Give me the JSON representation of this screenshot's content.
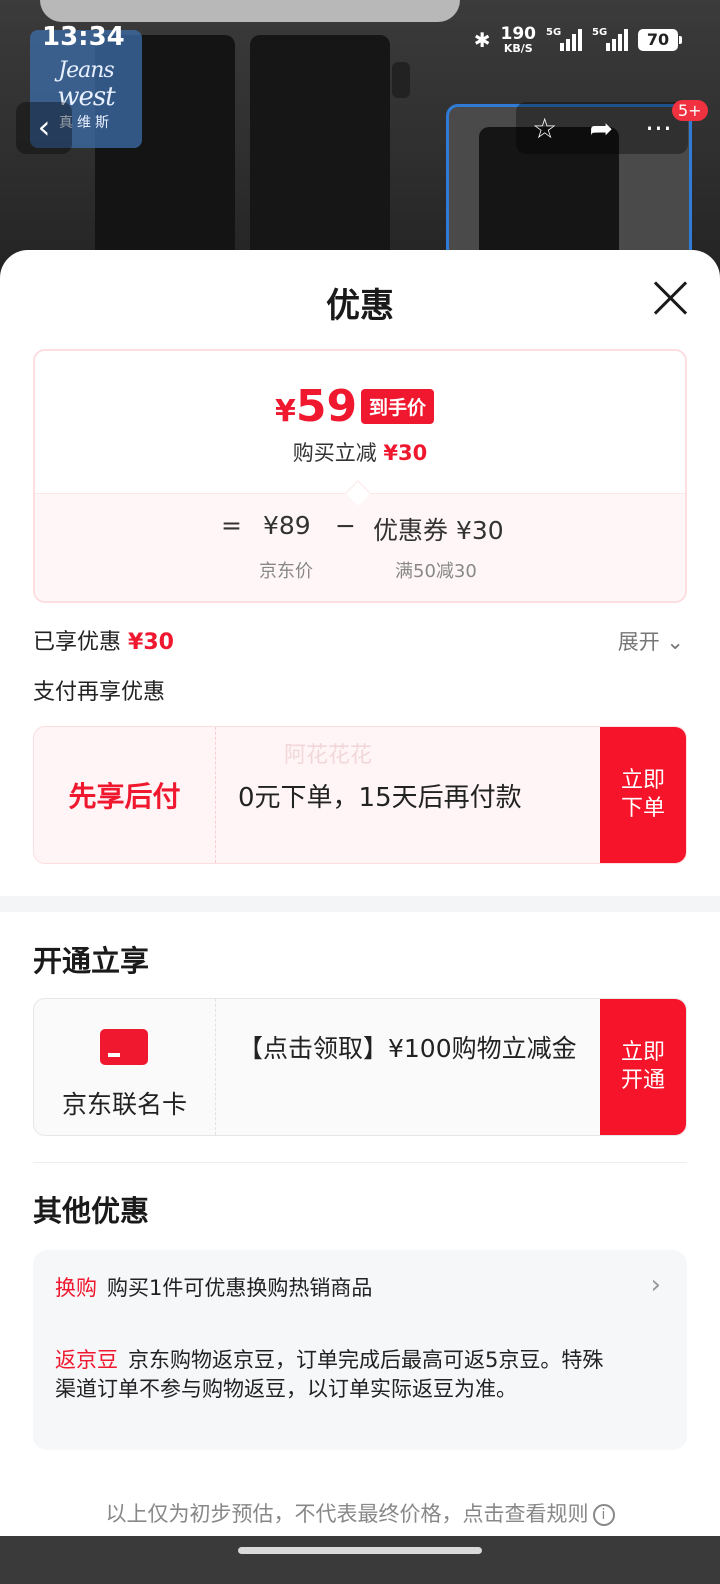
{
  "status_bar": {
    "time": "13:34",
    "net_speed_value": "190",
    "net_speed_unit": "KB/S",
    "signal1_label": "5G",
    "signal2_label": "5G",
    "battery": "70"
  },
  "brand": {
    "line1": "Jeans",
    "line2": "west",
    "line3": "真维斯"
  },
  "nav": {
    "notification_badge": "5+"
  },
  "sheet": {
    "title": "优惠",
    "price_card": {
      "currency": "¥",
      "final_price": "59",
      "final_tag": "到手价",
      "reduce_text": "购买立减",
      "reduce_amount": "¥30",
      "equals": "=",
      "jd_price": "¥89",
      "minus": "−",
      "coupon_text": "优惠券 ¥30",
      "jd_price_label": "京东价",
      "coupon_rule": "满50减30"
    },
    "enjoyed_label": "已享优惠",
    "enjoyed_amount": "¥30",
    "expand_label": "展开",
    "pay_again_label": "支付再享优惠",
    "pay_later": {
      "title": "先享后付",
      "desc": "0元下单，15天后再付款",
      "watermark": "阿花花花",
      "button": "立即下单"
    },
    "open_section_title": "开通立享",
    "card_offer": {
      "name": "京东联名卡",
      "desc": "【点击领取】¥100购物立减金",
      "button": "立即开通"
    },
    "other_section_title": "其他优惠",
    "other": {
      "exchange_label": "换购",
      "exchange_text": "购买1件可优惠换购热销商品",
      "bean_label": "返京豆",
      "bean_text": "京东购物返京豆，订单完成后最高可返5京豆。特殊渠道订单不参与购物返豆，以订单实际返豆为准。"
    },
    "disclaimer": "以上仅为初步预估，不代表最终价格，点击查看规则"
  },
  "colors": {
    "accent_red": "#f0182f",
    "button_red": "#f6142a",
    "light_pink_bg": "#fff5f6"
  }
}
